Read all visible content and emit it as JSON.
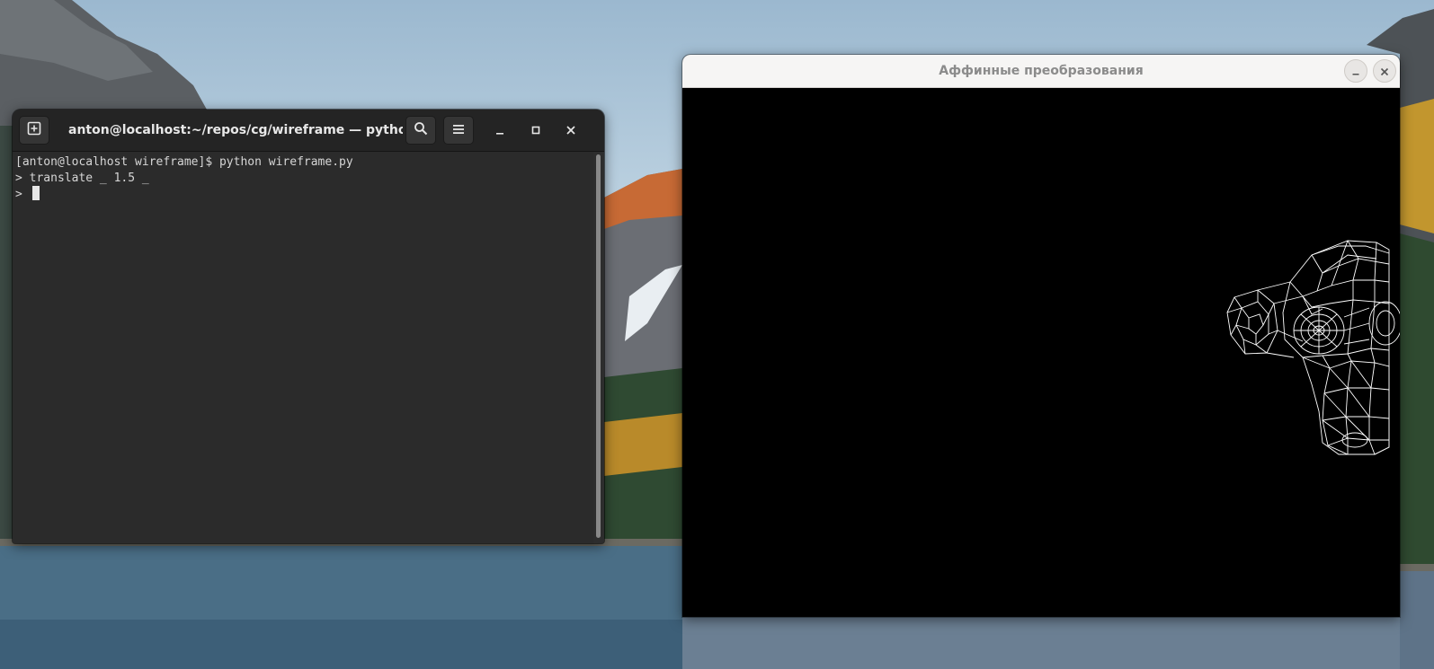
{
  "terminal": {
    "title": "anton@localhost:~/repos/cg/wireframe — python wi...",
    "lines": [
      "[anton@localhost wireframe]$ python wireframe.py",
      "> translate _ 1.5 _",
      "> "
    ],
    "icons": {
      "new_tab": "new-tab-icon",
      "search": "search-icon",
      "menu": "hamburger-menu-icon",
      "minimize": "minimize-icon",
      "maximize": "maximize-icon",
      "close": "close-icon"
    }
  },
  "graphics_window": {
    "title": "Аффинные преобразования",
    "icons": {
      "minimize": "minimize-icon",
      "close": "close-icon"
    },
    "canvas_background": "#000000",
    "wireframe_color": "#ffffff"
  },
  "colors": {
    "terminal_bg": "#2b2b2b",
    "terminal_header": "#242424",
    "terminal_text": "#d6d6d6",
    "graphics_header": "#f6f5f4"
  }
}
